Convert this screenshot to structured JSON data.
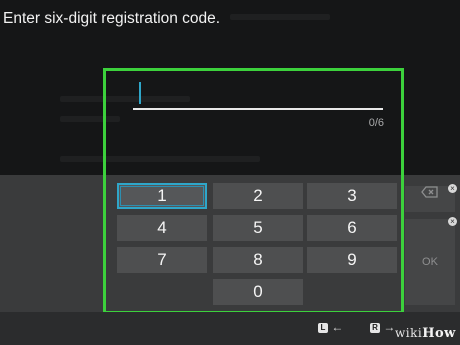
{
  "prompt": "Enter six-digit registration code.",
  "code_field": {
    "value": "",
    "counter": "0/6"
  },
  "keypad": [
    {
      "label": "1",
      "selected": true
    },
    {
      "label": "2"
    },
    {
      "label": "3"
    },
    {
      "label": "4"
    },
    {
      "label": "5"
    },
    {
      "label": "6"
    },
    {
      "label": "7"
    },
    {
      "label": "8"
    },
    {
      "label": "9"
    },
    {
      "label": "0"
    }
  ],
  "side": {
    "backspace_icon": "backspace-icon",
    "ok_label": "OK"
  },
  "footer": {
    "left_button": "L",
    "left_arrow": "←",
    "right_button": "R",
    "right_arrow": "→"
  },
  "watermark": {
    "wiki": "wiki",
    "how": "How"
  },
  "colors": {
    "highlight": "#3cd13c",
    "accent": "#2fa6c9"
  }
}
